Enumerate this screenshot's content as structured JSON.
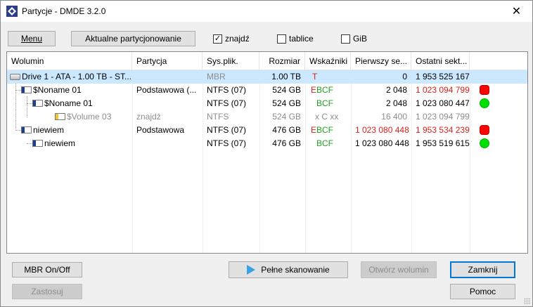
{
  "window": {
    "title": "Partycje - DMDE 3.2.0",
    "close_symbol": "✕"
  },
  "toolbar": {
    "menu_label": "Menu",
    "current_partitioning_label": "Aktualne partycjonowanie",
    "checks": [
      {
        "label": "znajdź",
        "checked": true
      },
      {
        "label": "tablice",
        "checked": false
      },
      {
        "label": "GiB",
        "checked": false
      }
    ]
  },
  "table": {
    "columns": [
      "Wolumin",
      "Partycja",
      "Sys.plik.",
      "Rozmiar",
      "Wskaźniki",
      "Pierwszy se...",
      "Ostatni sekt..."
    ],
    "rows": [
      {
        "volume": "Drive 1 - ATA - 1.00 TB - ST...",
        "partition": "",
        "fs": "MBR",
        "size": "1.00 TB",
        "flags": "T",
        "first": "0",
        "last": "1 953 525 167",
        "status": ""
      },
      {
        "volume": "$Noname 01",
        "partition": "Podstawowa (...",
        "fs": "NTFS (07)",
        "size": "524 GB",
        "flags_e": "E",
        "flags": "BCF",
        "first": "2 048",
        "last": "1 023 094 799",
        "status": "red"
      },
      {
        "volume": "$Noname 01",
        "partition": "",
        "fs": "NTFS (07)",
        "size": "524 GB",
        "flags": "BCF",
        "first": "2 048",
        "last": "1 023 080 447",
        "status": "green"
      },
      {
        "volume": "$Volume 03",
        "partition": "znajdź",
        "fs": "NTFS",
        "size": "524 GB",
        "flags": "x C xx",
        "first": "16 400",
        "last": "1 023 094 799",
        "status": ""
      },
      {
        "volume": "niewiem",
        "partition": "Podstawowa",
        "fs": "NTFS (07)",
        "size": "476 GB",
        "flags_e": "E",
        "flags": "BCF",
        "first": "1 023 080 448",
        "last": "1 953 534 239",
        "status": "red"
      },
      {
        "volume": "niewiem",
        "partition": "",
        "fs": "NTFS (07)",
        "size": "476 GB",
        "flags": "BCF",
        "first": "1 023 080 448",
        "last": "1 953 519 615",
        "status": "green"
      }
    ]
  },
  "buttons": {
    "mbr_onoff": "MBR On/Off",
    "apply": "Zastosuj",
    "full_scan": "Pełne skanowanie",
    "open_volume": "Otwórz wolumin",
    "close": "Zamknij",
    "help": "Pomoc"
  },
  "colors": {
    "selection": "#cce8ff",
    "error_red": "#e0201a",
    "ok_green": "#20a020"
  }
}
